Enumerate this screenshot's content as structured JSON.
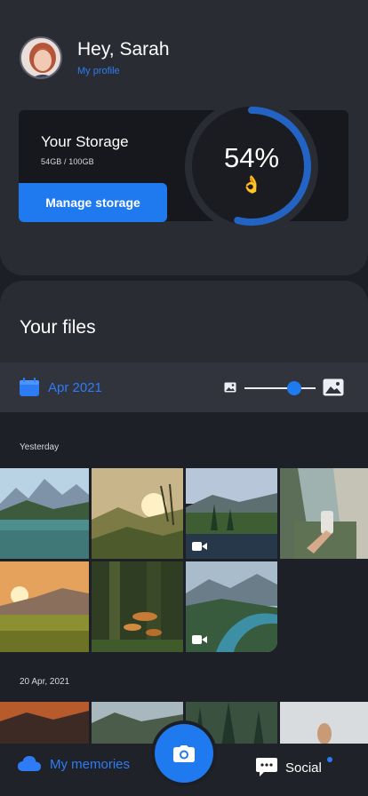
{
  "profile": {
    "greeting": "Hey, Sarah",
    "profile_link": "My profile"
  },
  "storage": {
    "title": "Your Storage",
    "usage": "54GB / 100GB",
    "percent_label": "54%",
    "percent_value": 54,
    "emoji": "👌",
    "manage_label": "Manage storage"
  },
  "files": {
    "title": "Your files",
    "month": "Apr 2021",
    "thumbnail_size_level": 0.7,
    "sections": [
      {
        "label": "Yesterday"
      },
      {
        "label": "20 Apr, 2021"
      }
    ]
  },
  "nav": {
    "memories_label": "My memories",
    "social_label": "Social"
  },
  "colors": {
    "accent": "#1f7af0",
    "surface": "#2a2c34",
    "background": "#1d1f26"
  },
  "icons": [
    "calendar-icon",
    "image-small-icon",
    "image-large-icon",
    "video-icon",
    "camera-icon",
    "cloud-icon",
    "chat-icon"
  ]
}
